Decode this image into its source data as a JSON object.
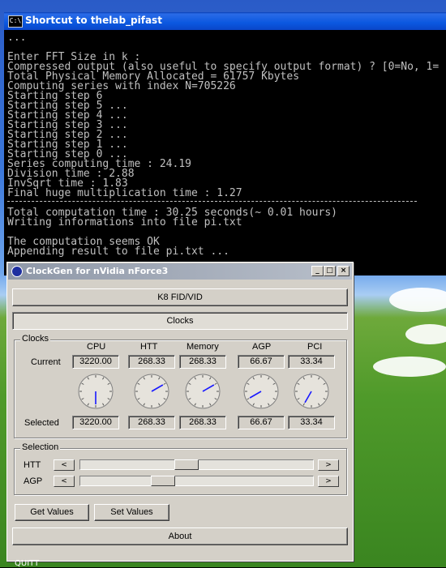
{
  "console": {
    "title": "Shortcut to thelab_pifast",
    "lines": [
      "...",
      "",
      "Enter FFT Size in k :",
      "Compressed output (also useful to specify output format) ? [0=No, 1=",
      "Total Physical Memory Allocated = 61757 Kbytes",
      "Computing series with index N=705226",
      "Starting step 6",
      "Starting step 5 ...",
      "Starting step 4 ...",
      "Starting step 3 ...",
      "Starting step 2 ...",
      "Starting step 1 ...",
      "Starting step 0 ...",
      "Series computing time : 24.19",
      "Division time : 2.88",
      "InvSqrt time : 1.83",
      "Final huge multiplication time : 1.27",
      "---",
      "Total computation time : 30.25 seconds(~ 0.01 hours)",
      "Writing informations into file pi.txt",
      "",
      "The computation seems OK",
      "Appending result to file pi.txt ..."
    ]
  },
  "clockgen": {
    "title": "ClockGen for nVidia nForce3",
    "window_buttons": [
      "_",
      "□",
      "×"
    ],
    "tab_k8": "K8 FID/VID",
    "tab_clocks": "Clocks",
    "clocks_group": "Clocks",
    "columns": [
      "CPU",
      "HTT",
      "Memory",
      "AGP",
      "PCI"
    ],
    "row_current_label": "Current",
    "row_selected_label": "Selected",
    "current": [
      "3220.00",
      "268.33",
      "268.33",
      "66.67",
      "33.34"
    ],
    "selected": [
      "3220.00",
      "268.33",
      "268.33",
      "66.67",
      "33.34"
    ],
    "gauge_angles_deg": [
      180,
      60,
      60,
      240,
      210
    ],
    "selection_group": "Selection",
    "htt_label": "HTT",
    "agp_label": "AGP",
    "htt_slider_fraction": 0.45,
    "agp_slider_fraction": 0.34,
    "left_arrow": "<",
    "right_arrow": ">",
    "get_values": "Get Values",
    "set_values": "Set Values",
    "about": "About"
  },
  "taskbar": {
    "partial_text": "QUITT"
  },
  "colors": {
    "title_blue": "#0b58e0",
    "console_text": "#c0c0c0",
    "gauge_needle": "#1a1aff"
  }
}
